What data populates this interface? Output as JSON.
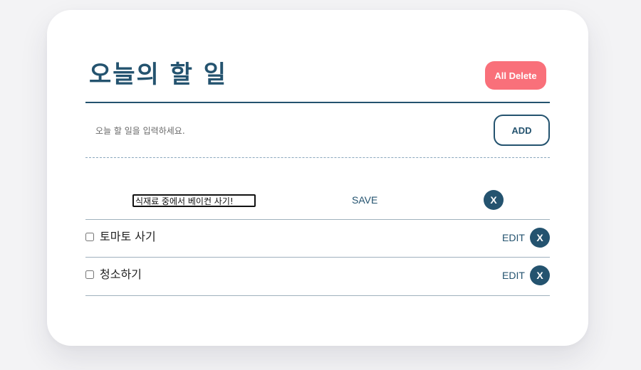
{
  "header": {
    "title": "오늘의 할 일",
    "delete_all_label": "All Delete"
  },
  "new_todo": {
    "placeholder": "오늘 할 일을 입력하세요.",
    "value": "",
    "add_label": "ADD"
  },
  "todos": [
    {
      "text": "식재료 중에서 베이컨 사기!",
      "editing": true,
      "checked": false,
      "save_label": "SAVE",
      "delete_label": "X"
    },
    {
      "text": "토마토 사기",
      "editing": false,
      "checked": false,
      "edit_label": "EDIT",
      "delete_label": "X"
    },
    {
      "text": "청소하기",
      "editing": false,
      "checked": false,
      "edit_label": "EDIT",
      "delete_label": "X"
    }
  ],
  "colors": {
    "accent": "#24536f",
    "delete_all": "#f9707a",
    "background": "#f3f3f5",
    "card": "#ffffff"
  }
}
